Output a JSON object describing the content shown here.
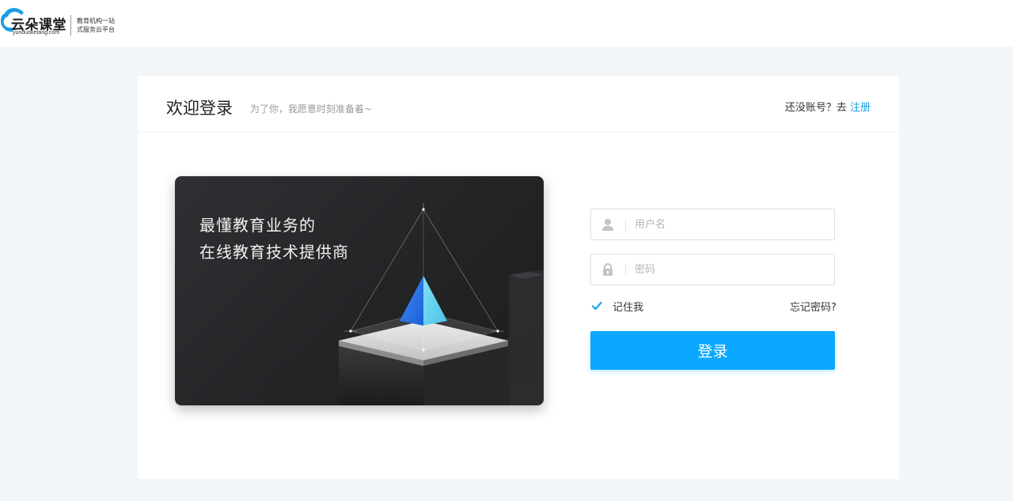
{
  "brand": {
    "name": "云朵课堂",
    "domain": "yunduoketang.com",
    "slogan_line1": "教育机构一站",
    "slogan_line2": "式服务云平台",
    "color": "#1a9be6"
  },
  "login_card": {
    "title": "欢迎登录",
    "subtitle": "为了你，我愿意时刻准备着~",
    "register_prompt": "还没账号？去",
    "register_link": "注册"
  },
  "banner": {
    "line1": "最懂教育业务的",
    "line2": "在线教育技术提供商"
  },
  "form": {
    "username_placeholder": "用户名",
    "password_placeholder": "密码",
    "remember_label": "记住我",
    "remember_checked": true,
    "forgot_label": "忘记密码?",
    "submit_label": "登录"
  },
  "colors": {
    "accent": "#0aa8ff",
    "link": "#17a2e6",
    "page_bg": "#f3f6f9"
  }
}
